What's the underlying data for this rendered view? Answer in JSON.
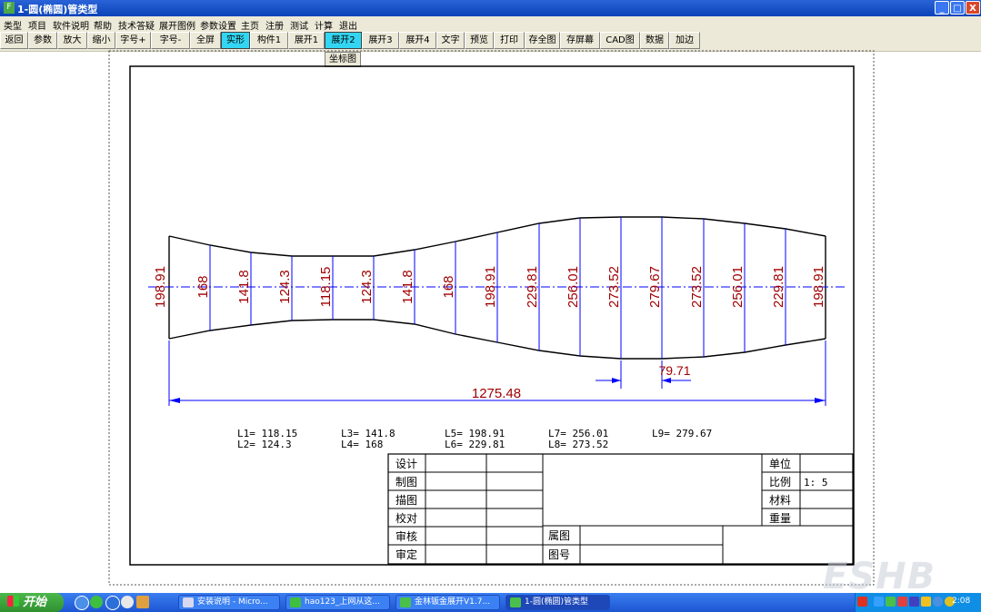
{
  "window": {
    "title": "1-圆(椭圆)管类型",
    "icon": "app-icon",
    "min": "_",
    "max": "□",
    "close": "X"
  },
  "menu": [
    "类型",
    "项目",
    "软件说明",
    "帮助",
    "技术答疑",
    "展开图例",
    "参数设置",
    "主页",
    "注册",
    "测试",
    "计算",
    "退出"
  ],
  "toolbar": [
    "返回",
    "参数",
    "放大",
    "缩小",
    "字号+",
    "字号-",
    "全屏",
    "实形",
    "构件1",
    "展开1",
    "展开2",
    "展开3",
    "展开4",
    "文字",
    "预览",
    "打印",
    "存全图",
    "存屏幕",
    "CAD图",
    "数据",
    "加边"
  ],
  "toolbar_active": [
    "实形",
    "展开2"
  ],
  "dropdown_item": "坐标图",
  "drawing": {
    "station_labels": [
      "198.91",
      "168",
      "141.8",
      "124.3",
      "118.15",
      "124.3",
      "141.8",
      "168",
      "198.91",
      "229.81",
      "256.01",
      "273.52",
      "279.67",
      "273.52",
      "256.01",
      "229.81",
      "198.91"
    ],
    "total_length": "1275.48",
    "spacing": "79.71",
    "legend": [
      [
        "L1= 118.15",
        "L2= 124.3"
      ],
      [
        "L3= 141.8",
        "L4= 168"
      ],
      [
        "L5= 198.91",
        "L6= 229.81"
      ],
      [
        "L7= 256.01",
        "L8= 273.52"
      ],
      [
        "L9= 279.67",
        ""
      ]
    ],
    "title_block": {
      "left_rows": [
        "设计",
        "制图",
        "描图",
        "校对",
        "审核",
        "审定"
      ],
      "right_rows": [
        "单位",
        "比例",
        "材料",
        "重量"
      ],
      "scale_value": "1: 5",
      "mid_labels": [
        "属图",
        "图号"
      ]
    },
    "colors": {
      "profile": "#000000",
      "stations": "#0000ff",
      "labels": "#a00000",
      "centerline": "#0000ff"
    }
  },
  "taskbar": {
    "start": "开始",
    "tasks": [
      "安装说明 - Micro...",
      "hao123_上网从这...",
      "金林钣金展开V1.7...",
      "1-圆(椭圆)管类型"
    ],
    "clock": "2:08"
  },
  "watermark": "ESHB"
}
